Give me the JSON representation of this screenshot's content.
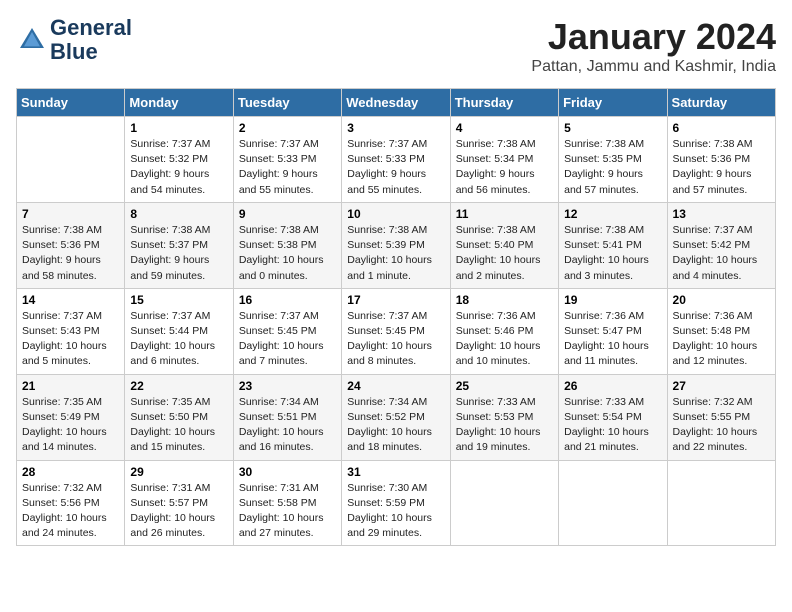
{
  "header": {
    "logo_line1": "General",
    "logo_line2": "Blue",
    "month_title": "January 2024",
    "location": "Pattan, Jammu and Kashmir, India"
  },
  "weekdays": [
    "Sunday",
    "Monday",
    "Tuesday",
    "Wednesday",
    "Thursday",
    "Friday",
    "Saturday"
  ],
  "weeks": [
    [
      {
        "day": "",
        "info": ""
      },
      {
        "day": "1",
        "info": "Sunrise: 7:37 AM\nSunset: 5:32 PM\nDaylight: 9 hours\nand 54 minutes."
      },
      {
        "day": "2",
        "info": "Sunrise: 7:37 AM\nSunset: 5:33 PM\nDaylight: 9 hours\nand 55 minutes."
      },
      {
        "day": "3",
        "info": "Sunrise: 7:37 AM\nSunset: 5:33 PM\nDaylight: 9 hours\nand 55 minutes."
      },
      {
        "day": "4",
        "info": "Sunrise: 7:38 AM\nSunset: 5:34 PM\nDaylight: 9 hours\nand 56 minutes."
      },
      {
        "day": "5",
        "info": "Sunrise: 7:38 AM\nSunset: 5:35 PM\nDaylight: 9 hours\nand 57 minutes."
      },
      {
        "day": "6",
        "info": "Sunrise: 7:38 AM\nSunset: 5:36 PM\nDaylight: 9 hours\nand 57 minutes."
      }
    ],
    [
      {
        "day": "7",
        "info": "Sunrise: 7:38 AM\nSunset: 5:36 PM\nDaylight: 9 hours\nand 58 minutes."
      },
      {
        "day": "8",
        "info": "Sunrise: 7:38 AM\nSunset: 5:37 PM\nDaylight: 9 hours\nand 59 minutes."
      },
      {
        "day": "9",
        "info": "Sunrise: 7:38 AM\nSunset: 5:38 PM\nDaylight: 10 hours\nand 0 minutes."
      },
      {
        "day": "10",
        "info": "Sunrise: 7:38 AM\nSunset: 5:39 PM\nDaylight: 10 hours\nand 1 minute."
      },
      {
        "day": "11",
        "info": "Sunrise: 7:38 AM\nSunset: 5:40 PM\nDaylight: 10 hours\nand 2 minutes."
      },
      {
        "day": "12",
        "info": "Sunrise: 7:38 AM\nSunset: 5:41 PM\nDaylight: 10 hours\nand 3 minutes."
      },
      {
        "day": "13",
        "info": "Sunrise: 7:37 AM\nSunset: 5:42 PM\nDaylight: 10 hours\nand 4 minutes."
      }
    ],
    [
      {
        "day": "14",
        "info": "Sunrise: 7:37 AM\nSunset: 5:43 PM\nDaylight: 10 hours\nand 5 minutes."
      },
      {
        "day": "15",
        "info": "Sunrise: 7:37 AM\nSunset: 5:44 PM\nDaylight: 10 hours\nand 6 minutes."
      },
      {
        "day": "16",
        "info": "Sunrise: 7:37 AM\nSunset: 5:45 PM\nDaylight: 10 hours\nand 7 minutes."
      },
      {
        "day": "17",
        "info": "Sunrise: 7:37 AM\nSunset: 5:45 PM\nDaylight: 10 hours\nand 8 minutes."
      },
      {
        "day": "18",
        "info": "Sunrise: 7:36 AM\nSunset: 5:46 PM\nDaylight: 10 hours\nand 10 minutes."
      },
      {
        "day": "19",
        "info": "Sunrise: 7:36 AM\nSunset: 5:47 PM\nDaylight: 10 hours\nand 11 minutes."
      },
      {
        "day": "20",
        "info": "Sunrise: 7:36 AM\nSunset: 5:48 PM\nDaylight: 10 hours\nand 12 minutes."
      }
    ],
    [
      {
        "day": "21",
        "info": "Sunrise: 7:35 AM\nSunset: 5:49 PM\nDaylight: 10 hours\nand 14 minutes."
      },
      {
        "day": "22",
        "info": "Sunrise: 7:35 AM\nSunset: 5:50 PM\nDaylight: 10 hours\nand 15 minutes."
      },
      {
        "day": "23",
        "info": "Sunrise: 7:34 AM\nSunset: 5:51 PM\nDaylight: 10 hours\nand 16 minutes."
      },
      {
        "day": "24",
        "info": "Sunrise: 7:34 AM\nSunset: 5:52 PM\nDaylight: 10 hours\nand 18 minutes."
      },
      {
        "day": "25",
        "info": "Sunrise: 7:33 AM\nSunset: 5:53 PM\nDaylight: 10 hours\nand 19 minutes."
      },
      {
        "day": "26",
        "info": "Sunrise: 7:33 AM\nSunset: 5:54 PM\nDaylight: 10 hours\nand 21 minutes."
      },
      {
        "day": "27",
        "info": "Sunrise: 7:32 AM\nSunset: 5:55 PM\nDaylight: 10 hours\nand 22 minutes."
      }
    ],
    [
      {
        "day": "28",
        "info": "Sunrise: 7:32 AM\nSunset: 5:56 PM\nDaylight: 10 hours\nand 24 minutes."
      },
      {
        "day": "29",
        "info": "Sunrise: 7:31 AM\nSunset: 5:57 PM\nDaylight: 10 hours\nand 26 minutes."
      },
      {
        "day": "30",
        "info": "Sunrise: 7:31 AM\nSunset: 5:58 PM\nDaylight: 10 hours\nand 27 minutes."
      },
      {
        "day": "31",
        "info": "Sunrise: 7:30 AM\nSunset: 5:59 PM\nDaylight: 10 hours\nand 29 minutes."
      },
      {
        "day": "",
        "info": ""
      },
      {
        "day": "",
        "info": ""
      },
      {
        "day": "",
        "info": ""
      }
    ]
  ]
}
